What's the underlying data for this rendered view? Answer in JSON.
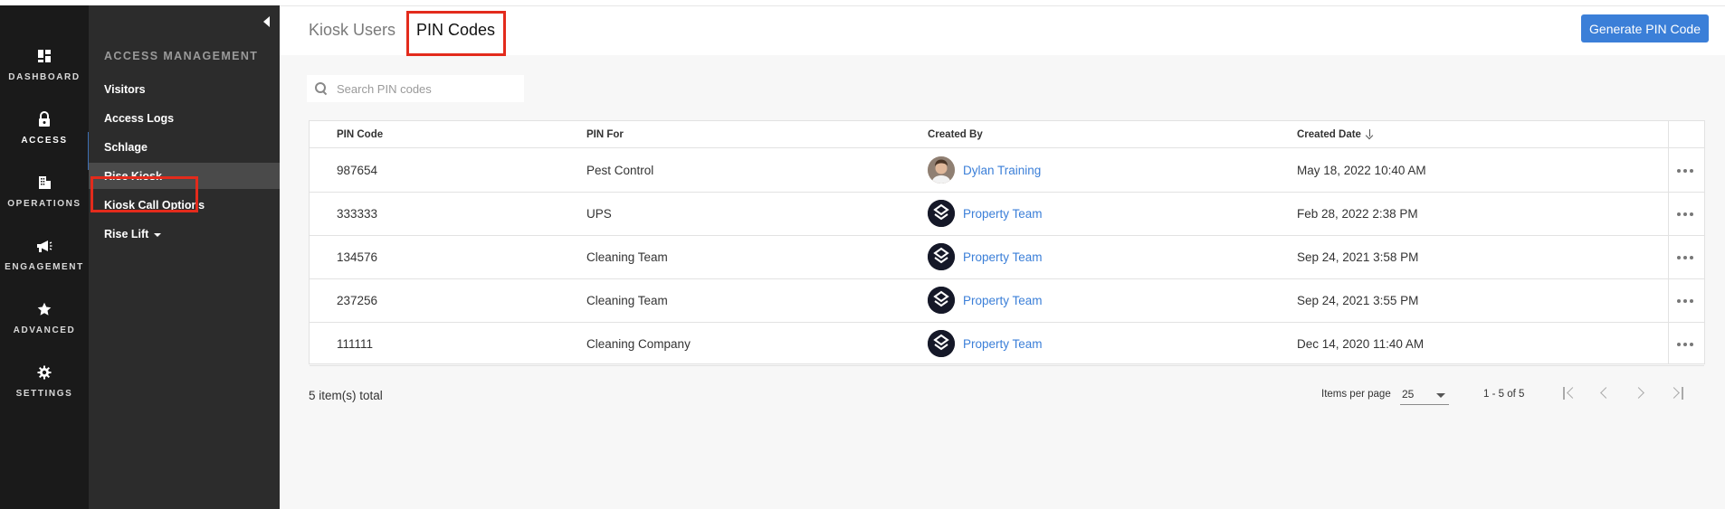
{
  "rail": {
    "items": [
      {
        "label": "DASHBOARD",
        "icon": "dashboard-icon"
      },
      {
        "label": "ACCESS",
        "icon": "lock-icon"
      },
      {
        "label": "OPERATIONS",
        "icon": "building-icon"
      },
      {
        "label": "ENGAGEMENT",
        "icon": "megaphone-icon"
      },
      {
        "label": "ADVANCED",
        "icon": "star-icon"
      },
      {
        "label": "SETTINGS",
        "icon": "gear-icon"
      }
    ]
  },
  "subnav": {
    "heading": "ACCESS MANAGEMENT",
    "items": [
      {
        "label": "Visitors"
      },
      {
        "label": "Access Logs"
      },
      {
        "label": "Schlage"
      },
      {
        "label": "Rise Kiosk"
      },
      {
        "label": "Kiosk Call Options"
      },
      {
        "label": "Rise Lift"
      }
    ]
  },
  "tabs": {
    "kiosk_users": "Kiosk Users",
    "pin_codes": "PIN Codes"
  },
  "actions": {
    "generate": "Generate PIN Code"
  },
  "search": {
    "placeholder": "Search PIN codes",
    "value": ""
  },
  "table": {
    "headers": {
      "pin_code": "PIN Code",
      "pin_for": "PIN For",
      "created_by": "Created By",
      "created_date": "Created Date"
    },
    "rows": [
      {
        "pin": "987654",
        "for": "Pest Control",
        "by": "Dylan Training",
        "avatar": "photo",
        "date": "May 18, 2022 10:40 AM"
      },
      {
        "pin": "333333",
        "for": "UPS",
        "by": "Property Team",
        "avatar": "logo",
        "date": "Feb 28, 2022 2:38 PM"
      },
      {
        "pin": "134576",
        "for": "Cleaning Team",
        "by": "Property Team",
        "avatar": "logo",
        "date": "Sep 24, 2021 3:58 PM"
      },
      {
        "pin": "237256",
        "for": "Cleaning Team",
        "by": "Property Team",
        "avatar": "logo",
        "date": "Sep 24, 2021 3:55 PM"
      },
      {
        "pin": "111111",
        "for": "Cleaning Company",
        "by": "Property Team",
        "avatar": "logo",
        "date": "Dec 14, 2020 11:40 AM"
      }
    ]
  },
  "footer": {
    "total": "5 item(s) total",
    "items_per_page_label": "Items per page",
    "items_per_page_value": "25",
    "range": "1 - 5 of 5"
  },
  "colors": {
    "accent": "#3b7fd8",
    "highlight": "#e32b1c",
    "rail_bg": "#1a1a1a",
    "subnav_bg": "#2c2c2c"
  }
}
